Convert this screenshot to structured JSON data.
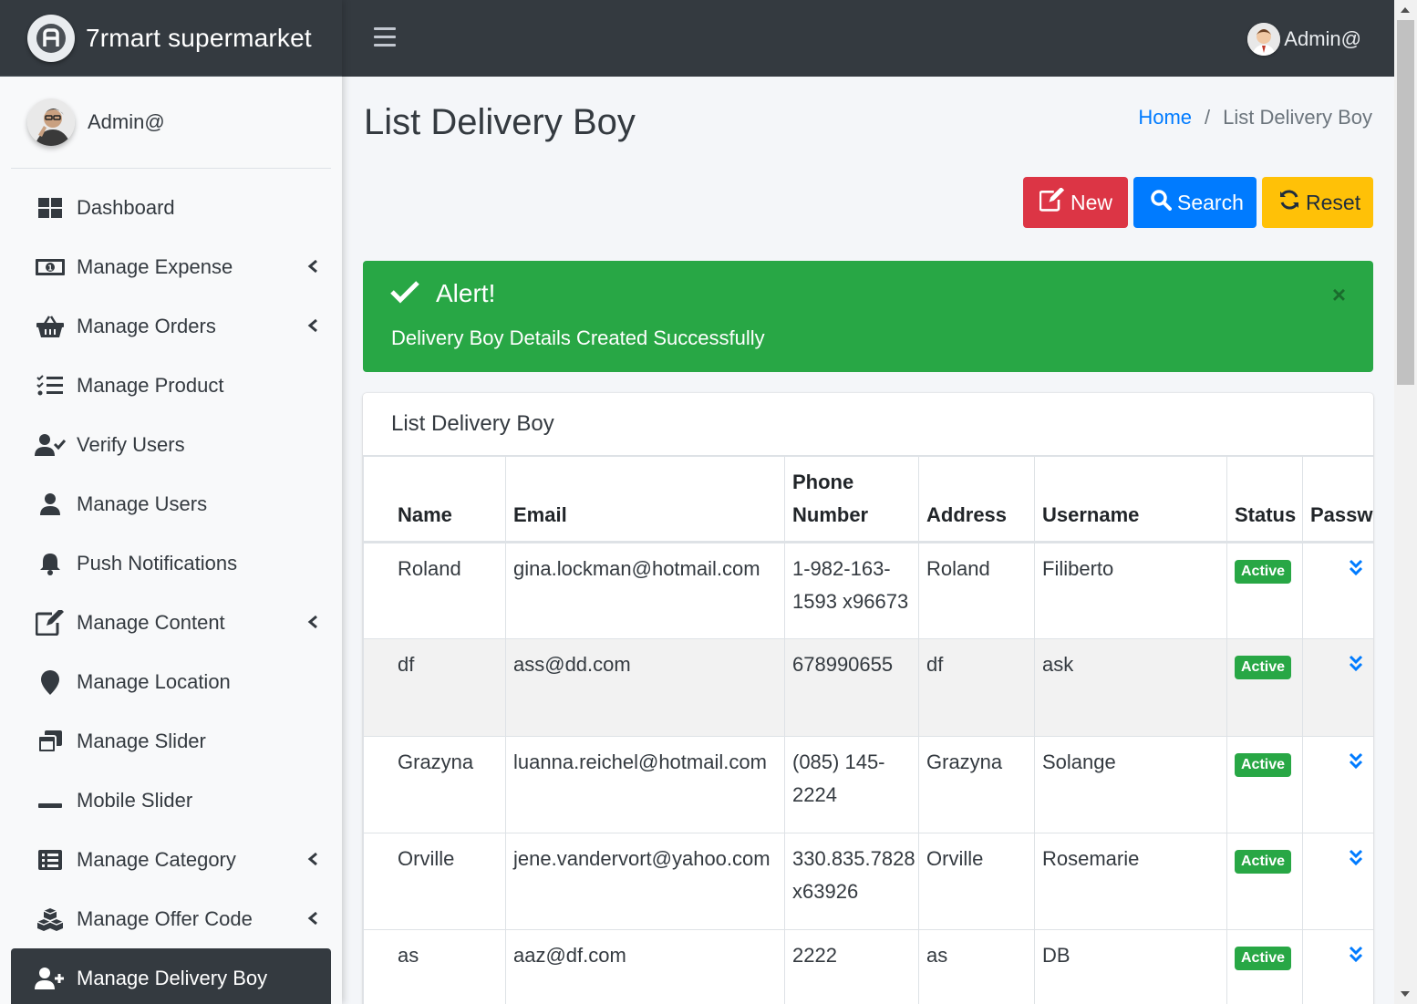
{
  "app": {
    "brand": "7rmart supermarket",
    "accent": "#007bff"
  },
  "topbar": {
    "user_name": "Admin@"
  },
  "sidebar": {
    "user_name": "Admin@",
    "items": [
      {
        "label": "Dashboard",
        "icon": "dashboard-icon",
        "has_arrow": false
      },
      {
        "label": "Manage Expense",
        "icon": "money-bill-icon",
        "has_arrow": true
      },
      {
        "label": "Manage Orders",
        "icon": "shopping-basket-icon",
        "has_arrow": true
      },
      {
        "label": "Manage Product",
        "icon": "tasks-list-icon",
        "has_arrow": false
      },
      {
        "label": "Verify Users",
        "icon": "user-check-icon",
        "has_arrow": false
      },
      {
        "label": "Manage Users",
        "icon": "user-icon",
        "has_arrow": false
      },
      {
        "label": "Push Notifications",
        "icon": "bell-icon",
        "has_arrow": false
      },
      {
        "label": "Manage Content",
        "icon": "edit-icon",
        "has_arrow": true
      },
      {
        "label": "Manage Location",
        "icon": "map-marker-icon",
        "has_arrow": false
      },
      {
        "label": "Manage Slider",
        "icon": "window-restore-icon",
        "has_arrow": false
      },
      {
        "label": "Mobile Slider",
        "icon": "minus-icon",
        "has_arrow": false
      },
      {
        "label": "Manage Category",
        "icon": "list-alt-icon",
        "has_arrow": true
      },
      {
        "label": "Manage Offer Code",
        "icon": "cubes-icon",
        "has_arrow": true
      },
      {
        "label": "Manage Delivery Boy",
        "icon": "user-plus-icon",
        "has_arrow": false,
        "active": true
      }
    ]
  },
  "page": {
    "title": "List Delivery Boy",
    "breadcrumb": {
      "home": "Home",
      "separator": "/",
      "current": "List Delivery Boy"
    }
  },
  "actions": {
    "new_label": "New",
    "search_label": "Search",
    "reset_label": "Reset"
  },
  "alert": {
    "title": "Alert!",
    "message": "Delivery Boy Details Created Successfully",
    "close": "×",
    "color": "#28a745"
  },
  "card": {
    "title": "List Delivery Boy"
  },
  "table": {
    "headers": {
      "name": "Name",
      "email": "Email",
      "phone": "Phone Number",
      "address": "Address",
      "username": "Username",
      "status": "Status",
      "password": "Password"
    },
    "rows": [
      {
        "name": "Roland",
        "email": "gina.lockman@hotmail.com",
        "phone": "1-982-163-1593 x96673",
        "address": "Roland",
        "username": "Filiberto",
        "status": "Active"
      },
      {
        "name": "df",
        "email": "ass@dd.com",
        "phone": "678990655",
        "address": "df",
        "username": "ask",
        "status": "Active"
      },
      {
        "name": "Grazyna",
        "email": "luanna.reichel@hotmail.com",
        "phone": "(085) 145-2224",
        "address": "Grazyna",
        "username": "Solange",
        "status": "Active"
      },
      {
        "name": "Orville",
        "email": "jene.vandervort@yahoo.com",
        "phone": "330.835.7828 x63926",
        "address": "Orville",
        "username": "Rosemarie",
        "status": "Active"
      },
      {
        "name": "as",
        "email": "aaz@df.com",
        "phone": "2222",
        "address": "as",
        "username": "DB",
        "status": "Active"
      }
    ]
  }
}
